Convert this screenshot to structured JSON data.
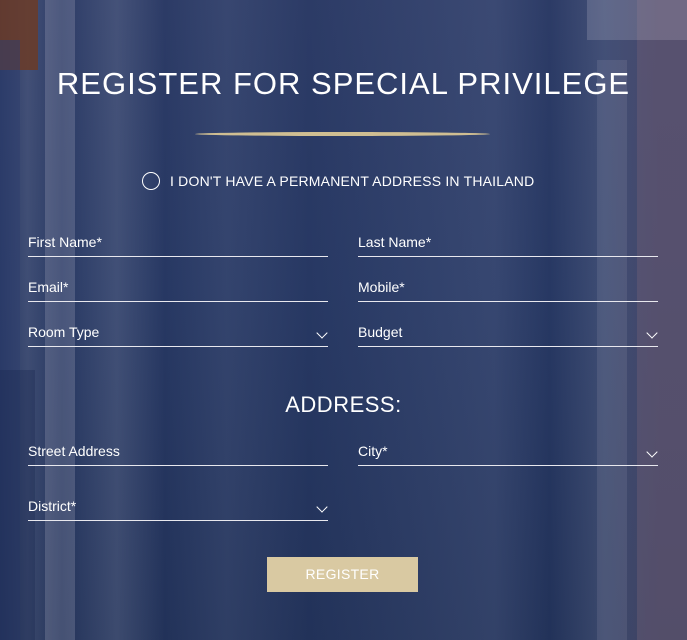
{
  "form": {
    "title": "REGISTER FOR SPECIAL PRIVILEGE",
    "no_address_label": "I DON'T HAVE A PERMANENT ADDRESS IN THAILAND",
    "first_name": "First Name*",
    "last_name": "Last Name*",
    "email": "Email*",
    "mobile": "Mobile*",
    "room_type": "Room Type",
    "budget": "Budget",
    "address_heading": "ADDRESS:",
    "street": "Street Address",
    "city": "City*",
    "district": "District*",
    "submit": "REGISTER"
  },
  "colors": {
    "background": "#273863",
    "accent_gold": "#d9c9a2",
    "divider_gold": "#cfbe92"
  }
}
